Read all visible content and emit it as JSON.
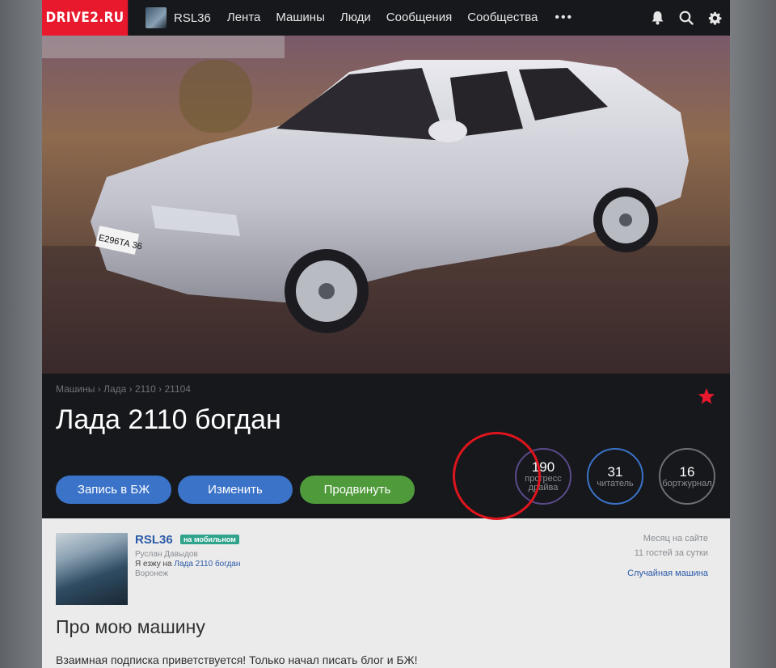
{
  "nav": {
    "logo": "DRIVE2.RU",
    "username": "RSL36",
    "links": [
      "Лента",
      "Машины",
      "Люди",
      "Сообщения",
      "Сообщества"
    ],
    "more": "•••",
    "icons": [
      "bell-icon",
      "search-icon",
      "gear-icon"
    ]
  },
  "hero": {
    "plate": "Е296ТА 36"
  },
  "car": {
    "breadcrumb": [
      "Машины",
      "Лада",
      "2110",
      "21104"
    ],
    "breadcrumb_sep": "›",
    "title": "Лада 2110 богдан",
    "favorite_icon": "star-icon"
  },
  "actions": {
    "journal_entry": "Запись в БЖ",
    "edit": "Изменить",
    "promote": "Продвинуть"
  },
  "stats": {
    "progress_value": "190",
    "progress_label_1": "прогресс",
    "progress_label_2": "драйва",
    "readers_value": "31",
    "readers_label": "читатель",
    "journal_value": "16",
    "journal_label": "бортжурнал"
  },
  "profile": {
    "nick": "RSL36",
    "mobile_badge": "на мобильном",
    "full_name": "Руслан Давыдов",
    "drive_prefix": "Я езжу на",
    "drive_link": "Лада 2110 богдан",
    "city": "Воронеж",
    "since": "Месяц на сайте",
    "guests": "11 гостей за сутки",
    "random_car": "Случайная машина",
    "about_heading": "Про мою машину",
    "about_text": "Взаимная подписка приветствуется! Только начал писать блог и БЖ!"
  },
  "colors": {
    "brand": "#e8182d",
    "nav_bg": "#16181c",
    "button_blue": "#3b73c9",
    "button_green": "#4f9a3a",
    "link": "#2b5aa8",
    "highlight": "#e0141c"
  }
}
